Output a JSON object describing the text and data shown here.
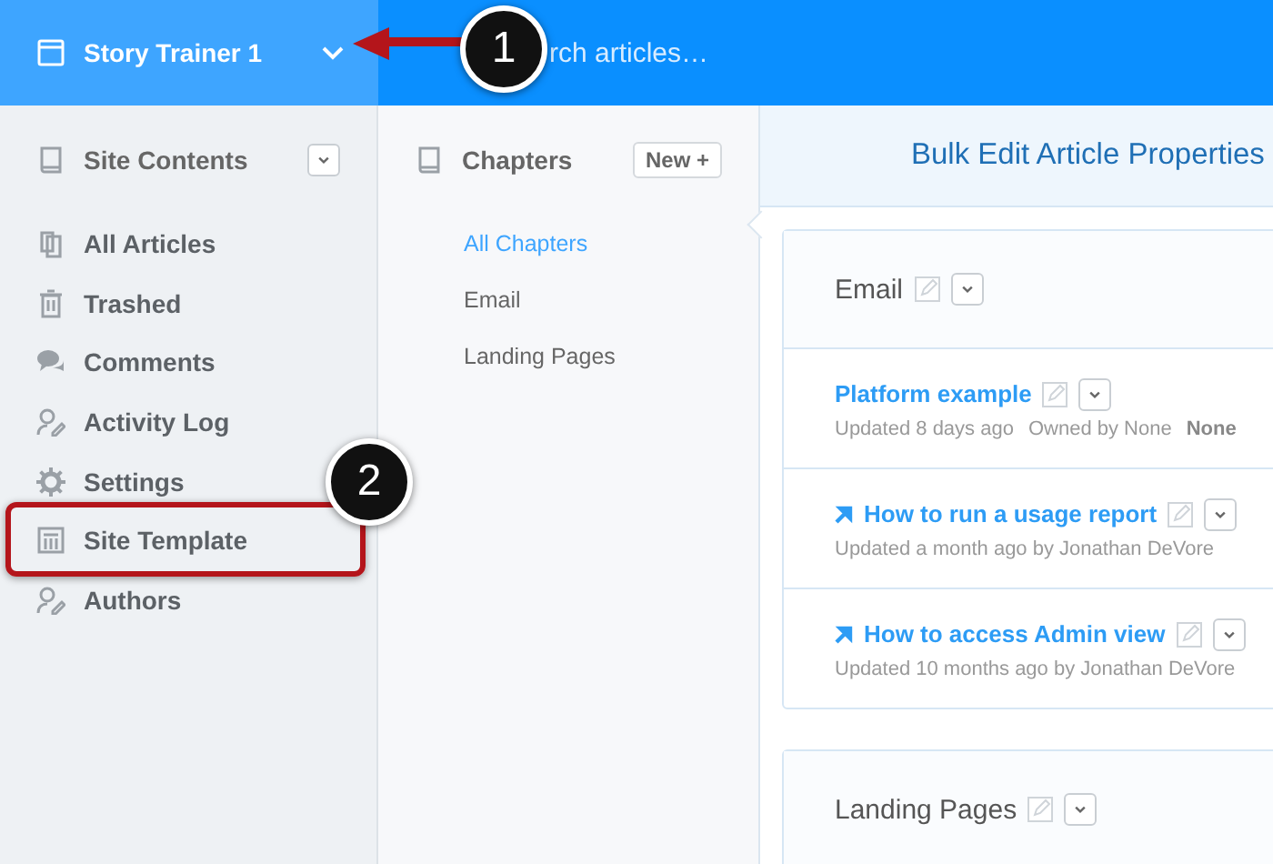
{
  "top_bar": {
    "site_name": "Story Trainer 1",
    "search": {
      "placeholder": "rch articles…"
    }
  },
  "sidebar": {
    "title": "Site Contents",
    "items": [
      {
        "label": "All Articles",
        "kind": "articles"
      },
      {
        "label": "Trashed",
        "kind": "trash"
      },
      {
        "label": "Comments",
        "kind": "comments"
      },
      {
        "label": "Activity Log",
        "kind": "activity"
      },
      {
        "label": "Settings",
        "kind": "settings"
      },
      {
        "label": "Site Template",
        "kind": "template"
      },
      {
        "label": "Authors",
        "kind": "authors"
      }
    ]
  },
  "chapters": {
    "title": "Chapters",
    "new_button": "New +",
    "items": [
      {
        "label": "All Chapters",
        "selected": true
      },
      {
        "label": "Email",
        "selected": false
      },
      {
        "label": "Landing Pages",
        "selected": false
      }
    ]
  },
  "main": {
    "header": "Bulk Edit Article Properties",
    "sections": [
      {
        "title": "Email",
        "articles": [
          {
            "title": "Platform example",
            "kind": "article",
            "meta": [
              "Updated 8 days ago",
              "Owned by None"
            ],
            "tag": "None"
          },
          {
            "title": "How to run a usage report",
            "kind": "link",
            "meta": [
              "Updated a month ago by Jonathan DeVore"
            ]
          },
          {
            "title": "How to access Admin view",
            "kind": "link",
            "meta": [
              "Updated 10 months ago by Jonathan DeVore"
            ]
          }
        ]
      },
      {
        "title": "Landing Pages"
      }
    ]
  },
  "callouts": [
    {
      "number": "1"
    },
    {
      "number": "2"
    }
  ]
}
